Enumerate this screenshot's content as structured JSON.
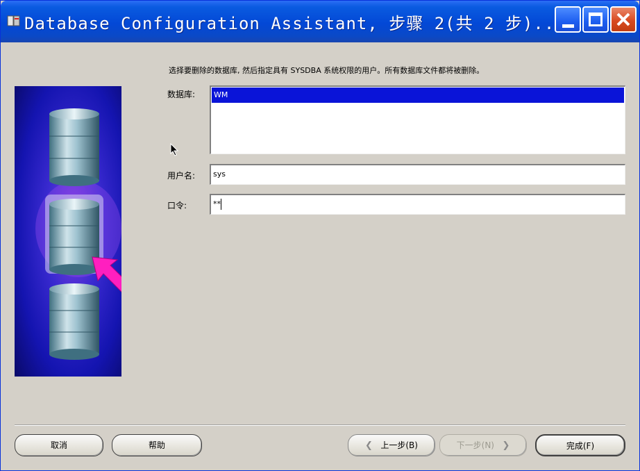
{
  "window": {
    "title": "Database Configuration Assistant, 步骤 2(共 2 步)..."
  },
  "form": {
    "instruction": "选择要删除的数据库, 然后指定具有 SYSDBA 系统权限的用户。所有数据库文件都将被删除。",
    "database_label": "数据库:",
    "databases": [
      "WM"
    ],
    "selected_database": "WM",
    "username_label": "用户名:",
    "username_value": "sys",
    "password_label": "口令:",
    "password_value": "**"
  },
  "buttons": {
    "cancel": "取消",
    "help": "帮助",
    "back": "上一步(B)",
    "next": "下一步(N)",
    "finish": "完成(F)"
  },
  "icons": {
    "app": "oracle-app-icon",
    "minimize": "minimize-icon",
    "maximize": "maximize-icon",
    "close": "close-icon",
    "back_arrow": "chevron-left-icon",
    "next_arrow": "chevron-right-icon"
  },
  "colors": {
    "title_bar": "#0348d6",
    "selection": "#0a14d8",
    "arrow_pointer": "#ff1fbf",
    "side_panel_bg": "#0a0e8a"
  }
}
